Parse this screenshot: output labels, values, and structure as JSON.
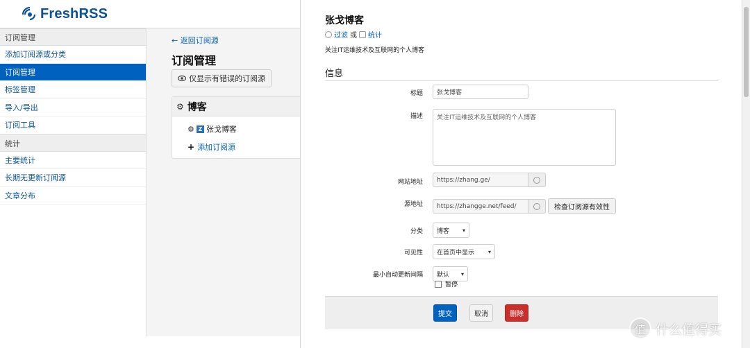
{
  "app": {
    "name": "FreshRSS"
  },
  "sidebar": {
    "sections": [
      {
        "title": "订阅管理",
        "items": [
          "添加订阅源或分类",
          "订阅管理",
          "标签管理",
          "导入/导出",
          "订阅工具"
        ]
      },
      {
        "title": "统计",
        "items": [
          "主要统计",
          "长期无更新订阅源",
          "文章分布"
        ]
      }
    ],
    "active_item": "订阅管理"
  },
  "middle": {
    "back_link": "← 返回订阅源",
    "title": "订阅管理",
    "error_filter_button": "仅显示有错误的订阅源",
    "category": {
      "name": "博客",
      "feeds": [
        "张戈博客"
      ],
      "add_feed": "添加订阅源"
    }
  },
  "feed": {
    "title": "张戈博客",
    "filter_link": "过滤",
    "or_text": "或",
    "stats_link": "统计",
    "description": "关注IT运维技术及互联网的个人博客",
    "section_info": "信息",
    "fields": {
      "title_label": "标题",
      "title_value": "张戈博客",
      "desc_label": "描述",
      "desc_value": "关注IT运维技术及互联网的个人博客",
      "website_label": "网站地址",
      "website_value": "https://zhang.ge/",
      "feed_url_label": "源地址",
      "feed_url_value": "https://zhangge.net/feed/",
      "check_button": "检查订阅源有效性",
      "category_label": "分类",
      "category_value": "博客",
      "visibility_label": "可见性",
      "visibility_value": "在首页中显示",
      "interval_label": "最小自动更新间隔",
      "interval_value": "默认",
      "pause_label": "暂停"
    },
    "actions": {
      "submit": "提交",
      "cancel": "取消",
      "delete": "删除"
    }
  },
  "watermark": {
    "text": "什么值得买",
    "glyph": "值"
  }
}
